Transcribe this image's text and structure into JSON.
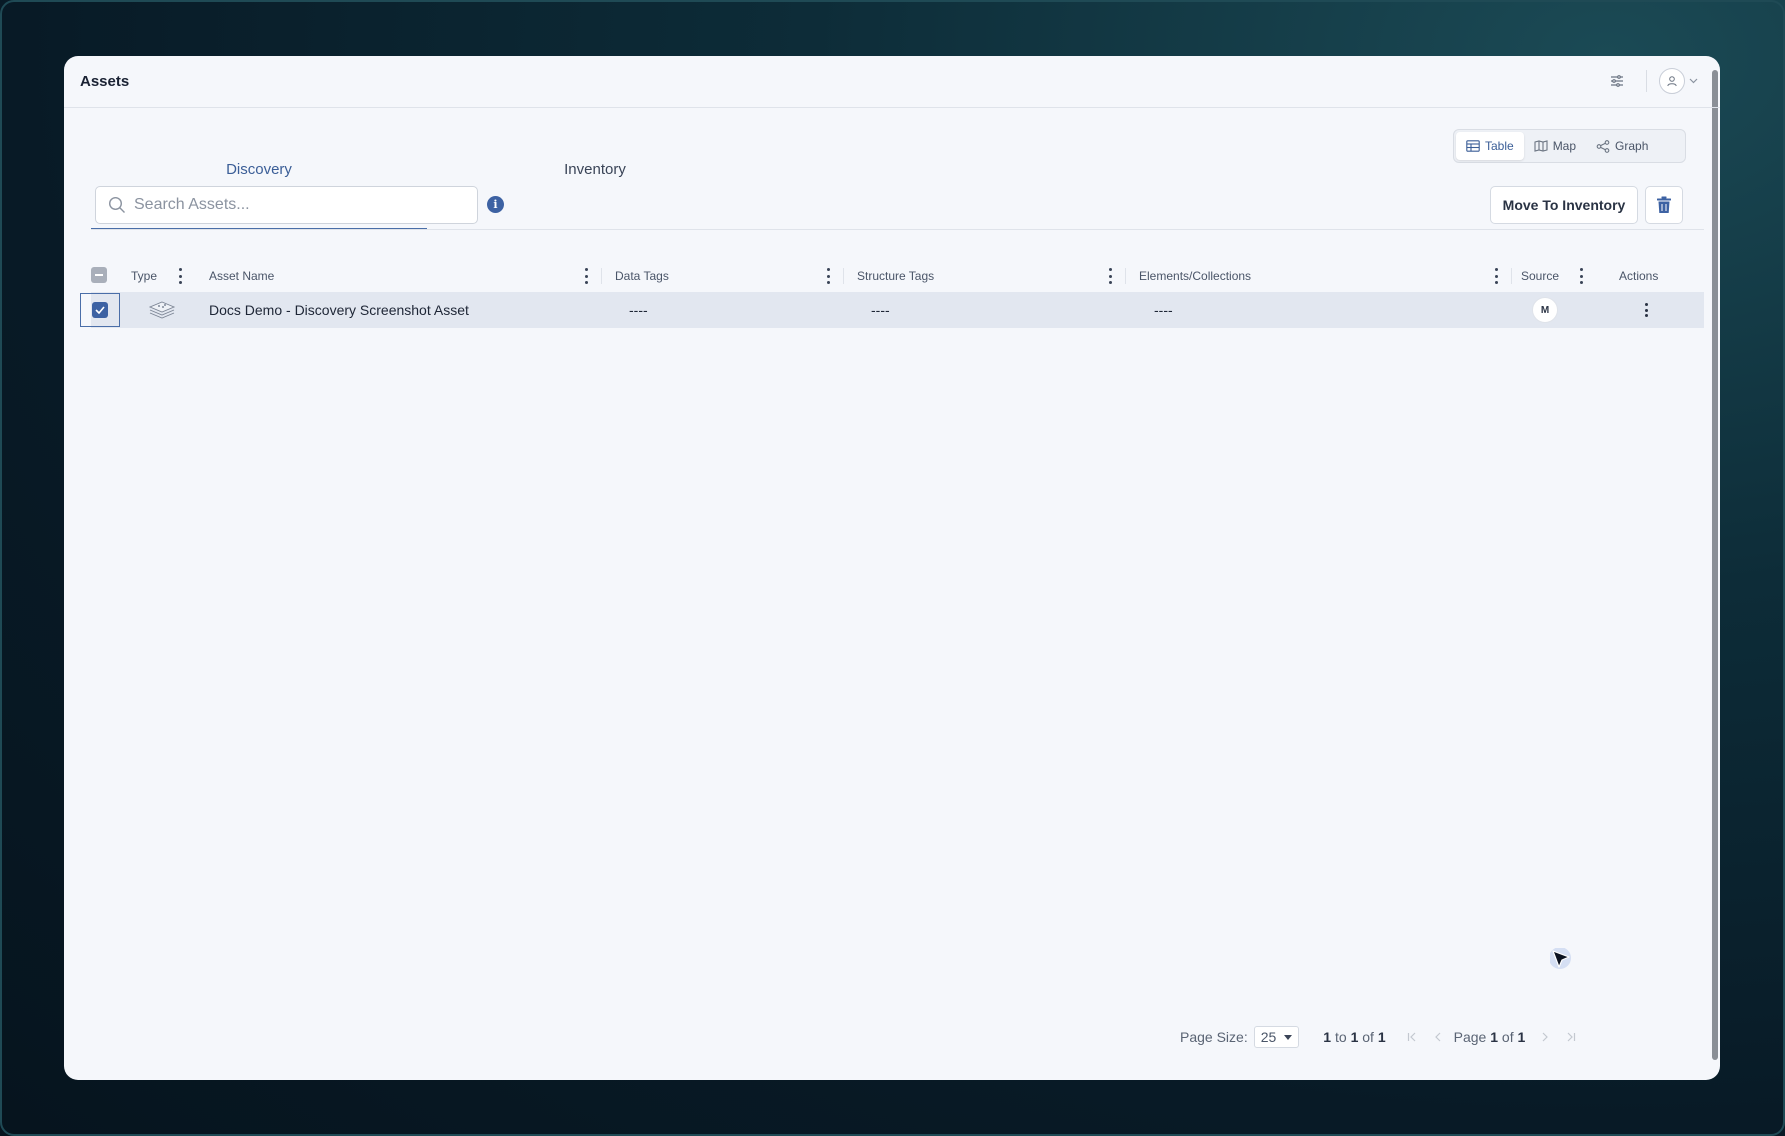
{
  "header": {
    "title": "Assets"
  },
  "tabs": [
    {
      "label": "Discovery",
      "active": true
    },
    {
      "label": "Inventory",
      "active": false
    }
  ],
  "view_switch": [
    {
      "label": "Table",
      "icon": "table-icon",
      "active": true
    },
    {
      "label": "Map",
      "icon": "map-icon",
      "active": false
    },
    {
      "label": "Graph",
      "icon": "share-graph-icon",
      "active": false
    }
  ],
  "search": {
    "placeholder": "Search Assets...",
    "value": ""
  },
  "toolbar": {
    "move_label": "Move To Inventory"
  },
  "table": {
    "columns": [
      "Type",
      "Asset Name",
      "Data Tags",
      "Structure Tags",
      "Elements/Collections",
      "Source",
      "Actions"
    ],
    "rows": [
      {
        "selected": true,
        "type_icon": "stacked-layers-icon",
        "asset_name": "Docs Demo - Discovery Screenshot Asset",
        "data_tags": "----",
        "structure_tags": "----",
        "elements_collections": "----",
        "source": "M"
      }
    ]
  },
  "pagination": {
    "page_size_label": "Page Size:",
    "page_size_value": "25",
    "range_from": "1",
    "range_to_word": "to",
    "range_to": "1",
    "range_of_word": "of",
    "range_total": "1",
    "page_word": "Page",
    "page_current": "1",
    "page_of_word": "of",
    "page_total": "1"
  },
  "colors": {
    "accent": "#3d62a3",
    "row_selected": "#e2e7f0",
    "background": "#f5f7fb"
  }
}
